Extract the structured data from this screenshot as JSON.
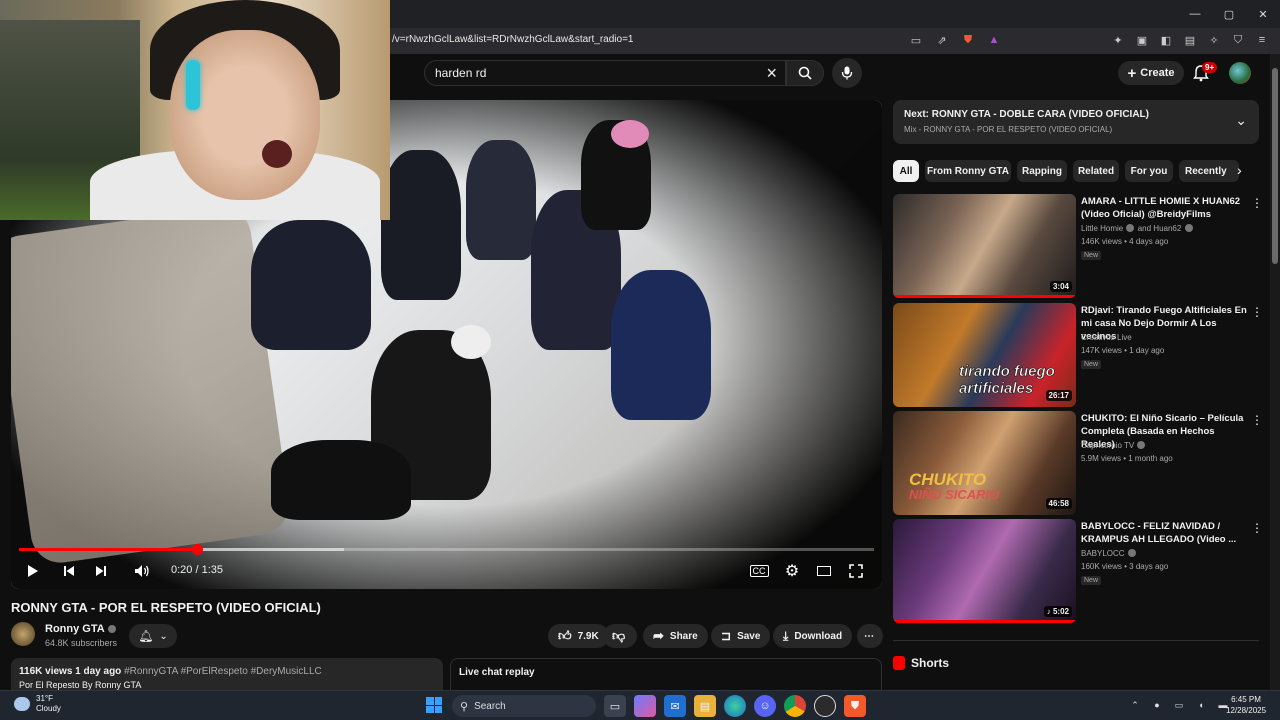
{
  "browser": {
    "url": "/v=rNwzhGclLaw&list=RDrNwzhGclLaw&start_radio=1",
    "window_controls": [
      "—",
      "▢",
      "✕"
    ]
  },
  "header": {
    "search_value": "harden rd",
    "create_label": "Create",
    "notif_badge": "9+"
  },
  "player": {
    "time": "0:20 / 1:35",
    "progress": 0.208,
    "buffered": 0.38
  },
  "video": {
    "title": "RONNY GTA - POR EL RESPETO (VIDEO OFICIAL)",
    "channel": "Ronny GTA",
    "subscribers": "64.8K subscribers",
    "likes": "7.9K",
    "share_label": "Share",
    "save_label": "Save",
    "download_label": "Download",
    "views_date": "116K views  1 day ago",
    "tags": "#RonnyGTA #PorElRespeto #DeryMusicLLC",
    "desc_line2": "Por El Repesto By Ronny GTA",
    "live_chat_label": "Live chat replay"
  },
  "mix": {
    "next": "Next: RONNY GTA - DOBLE CARA (VIDEO OFICIAL)",
    "sub": "Mix - RONNY GTA - POR EL RESPETO (VIDEO OFICIAL)"
  },
  "chips": [
    "All",
    "From Ronny GTA",
    "Rapping",
    "Related",
    "For you",
    "Recently"
  ],
  "recommendations": [
    {
      "title": "AMARA - LITTLE HOMIE X HUAN62 (Video Oficial) @BreidyFilms",
      "channel": "Little Homie",
      "channel2": "and Huan62",
      "views": "146K views • 4 days ago",
      "badge": "New",
      "duration": "3:04",
      "watched": 1.0
    },
    {
      "title": "RDjavi: Tirando Fuego Altificiales En mi casa No Dejo Dormir  A Los vecinos",
      "channel": "Creativos Live",
      "channel2": "",
      "views": "147K views • 1 day ago",
      "badge": "New",
      "duration": "26:17",
      "watched": 0
    },
    {
      "title": "CHUKITO: El Niño Sicario – Película Completa (Basada en Hechos Reales)",
      "channel": "Capricornio TV",
      "channel2": "",
      "views": "5.9M views • 1 month ago",
      "badge": "",
      "duration": "46:58",
      "watched": 0
    },
    {
      "title": "BABYLOCC - FELIZ NAVIDAD / KRAMPUS AH LLEGADO (Video ...",
      "channel": "BABYLOCC",
      "channel2": "",
      "views": "160K views • 3 days ago",
      "badge": "New",
      "duration": "5:02",
      "watched": 1.0
    }
  ],
  "shorts_label": "Shorts",
  "taskbar": {
    "temp": "31°F",
    "cond": "Cloudy",
    "search_label": "Search",
    "time": "6:45 PM",
    "date": "12/28/2025"
  }
}
